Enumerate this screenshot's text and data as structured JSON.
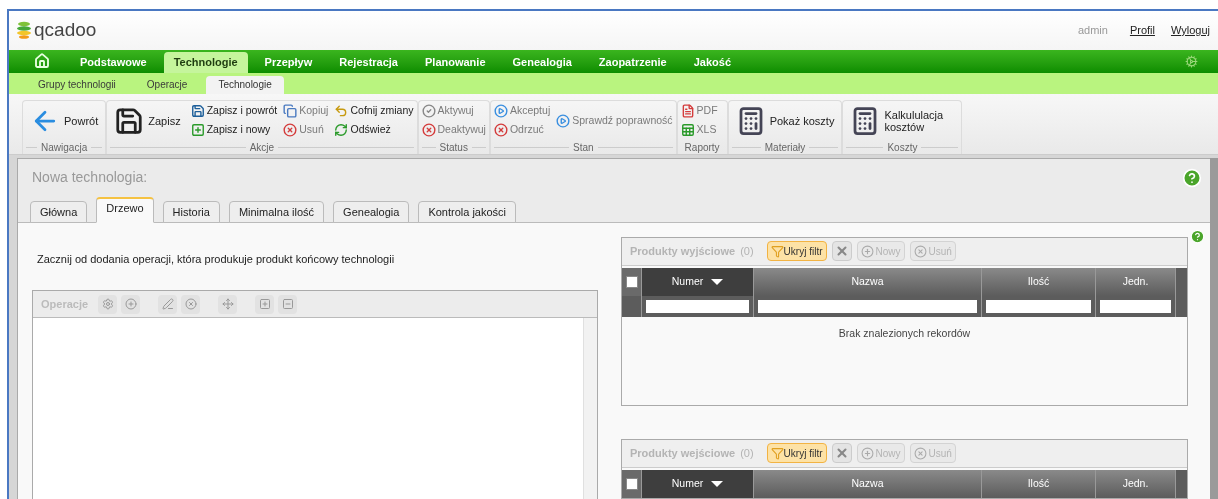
{
  "header": {
    "logo": "qcadoo",
    "user": "admin",
    "links": [
      "Profil",
      "Wyloguj"
    ]
  },
  "nav": {
    "items": [
      {
        "label": "Podstawowe",
        "selected": false
      },
      {
        "label": "Technologie",
        "selected": true
      },
      {
        "label": "Przepływ",
        "selected": false
      },
      {
        "label": "Rejestracja",
        "selected": false
      },
      {
        "label": "Planowanie",
        "selected": false
      },
      {
        "label": "Genealogia",
        "selected": false
      },
      {
        "label": "Zaopatrzenie",
        "selected": false
      },
      {
        "label": "Jakość",
        "selected": false
      }
    ]
  },
  "subnav": {
    "items": [
      {
        "label": "Grupy technologii",
        "selected": false
      },
      {
        "label": "Operacje",
        "selected": false
      },
      {
        "label": "Technologie",
        "selected": true
      }
    ]
  },
  "ribbon": {
    "groups": [
      {
        "label": "Nawigacja",
        "columns": [
          [
            {
              "kind": "large",
              "label": "Powrót",
              "disabled": false
            }
          ]
        ]
      },
      {
        "label": "Akcje",
        "columns": [
          [
            {
              "kind": "large",
              "label": "Zapisz",
              "disabled": false
            }
          ],
          [
            {
              "kind": "small",
              "label": "Zapisz i powrót",
              "disabled": false
            },
            {
              "kind": "small",
              "label": "Zapisz i nowy",
              "disabled": false
            }
          ],
          [
            {
              "kind": "small",
              "label": "Kopiuj",
              "disabled": true
            },
            {
              "kind": "small",
              "label": "Usuń",
              "disabled": true
            }
          ],
          [
            {
              "kind": "small",
              "label": "Cofnij zmiany",
              "disabled": false
            },
            {
              "kind": "small",
              "label": "Odśwież",
              "disabled": false
            }
          ]
        ]
      },
      {
        "label": "Status",
        "columns": [
          [
            {
              "kind": "small",
              "label": "Aktywuj",
              "disabled": true
            },
            {
              "kind": "small",
              "label": "Deaktywuj",
              "disabled": true
            }
          ]
        ]
      },
      {
        "label": "Stan",
        "columns": [
          [
            {
              "kind": "small",
              "label": "Akceptuj",
              "disabled": true
            },
            {
              "kind": "small",
              "label": "Odrzuć",
              "disabled": true
            }
          ],
          [
            {
              "kind": "small",
              "label": "Sprawdź poprawność",
              "disabled": true
            }
          ]
        ]
      },
      {
        "label": "Raporty",
        "columns": [
          [
            {
              "kind": "small",
              "label": "PDF",
              "disabled": true
            },
            {
              "kind": "small",
              "label": "XLS",
              "disabled": true
            }
          ]
        ]
      },
      {
        "label": "Materiały",
        "columns": [
          [
            {
              "kind": "large",
              "label": "Pokaż koszty",
              "disabled": false
            }
          ]
        ]
      },
      {
        "label": "Koszty",
        "columns": [
          [
            {
              "kind": "large",
              "label": "Kalkululacja kosztów",
              "disabled": false
            }
          ]
        ]
      }
    ]
  },
  "form": {
    "title": "Nowa technologia:",
    "tabs": [
      {
        "label": "Główna",
        "selected": false
      },
      {
        "label": "Drzewo",
        "selected": true
      },
      {
        "label": "Historia",
        "selected": false
      },
      {
        "label": "Minimalna ilość",
        "selected": false
      },
      {
        "label": "Genealogia",
        "selected": false
      },
      {
        "label": "Kontrola jakości",
        "selected": false
      }
    ],
    "instruction": "Zacznij od dodania operacji, która produkuje produkt końcowy technologii",
    "operations": {
      "title": "Operacje"
    },
    "grids": [
      {
        "title": "Produkty wyjściowe",
        "count": "(0)",
        "select_all_checked": false,
        "filter_button": {
          "label": "Ukryj filtr",
          "selected": true
        },
        "new_button": {
          "label": "Nowy",
          "disabled": true
        },
        "delete_button": {
          "label": "Usuń",
          "disabled": true
        },
        "columns": [
          {
            "label": "Numer",
            "sorted": true
          },
          {
            "label": "Nazwa",
            "sorted": false
          },
          {
            "label": "Ilość",
            "sorted": false
          },
          {
            "label": "Jedn.",
            "sorted": false
          }
        ],
        "empty_message": "Brak znalezionych rekordów"
      },
      {
        "title": "Produkty wejściowe",
        "count": "(0)",
        "select_all_checked": false,
        "filter_button": {
          "label": "Ukryj filtr",
          "selected": true
        },
        "new_button": {
          "label": "Nowy",
          "disabled": true
        },
        "delete_button": {
          "label": "Usuń",
          "disabled": true
        },
        "columns": [
          {
            "label": "Numer",
            "sorted": true
          },
          {
            "label": "Nazwa",
            "sorted": false
          },
          {
            "label": "Ilość",
            "sorted": false
          },
          {
            "label": "Jedn.",
            "sorted": false
          }
        ]
      }
    ]
  }
}
